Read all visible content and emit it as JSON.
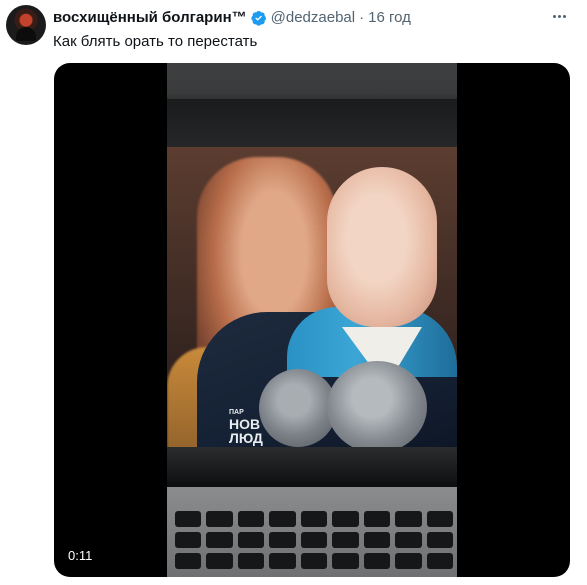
{
  "tweet": {
    "author": {
      "display_name": "восхищённый болгарин™",
      "handle": "@dedzaebal",
      "verified": true,
      "verified_color": "#1d9bf0"
    },
    "separator": "·",
    "time": "16 год",
    "text": "Как блять орать то перестать",
    "menu_icon": "more-icon",
    "media": {
      "type": "video",
      "duration": "0:11",
      "overlay_text": "НОВ\nЛЮД",
      "overlay_text_top": "ПАР"
    }
  },
  "colors": {
    "text_primary": "#0f1419",
    "text_secondary": "#536471",
    "accent": "#1d9bf0",
    "background": "#ffffff"
  }
}
